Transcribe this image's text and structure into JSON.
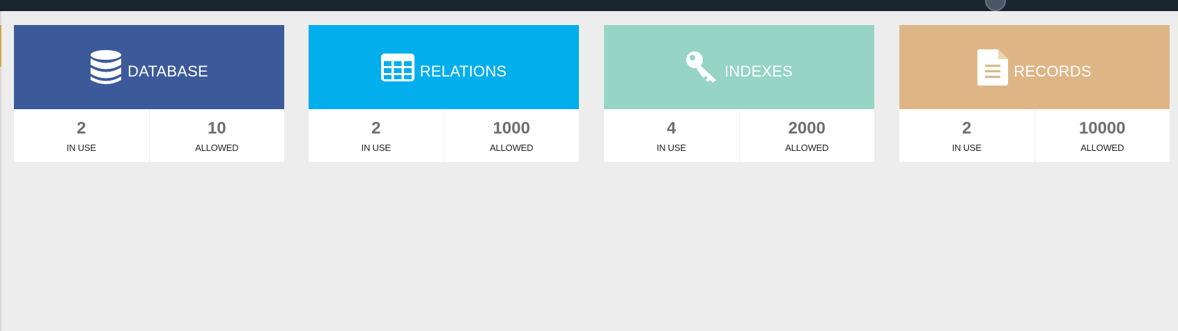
{
  "cards": [
    {
      "title": "DATABASE",
      "icon": "database-icon",
      "color": "#3c5a9a",
      "in_use_value": "2",
      "in_use_label": "IN USE",
      "allowed_value": "10",
      "allowed_label": "ALLOWED"
    },
    {
      "title": "RELATIONS",
      "icon": "table-grid-icon",
      "color": "#03aeed",
      "in_use_value": "2",
      "in_use_label": "IN USE",
      "allowed_value": "1000",
      "allowed_label": "ALLOWED"
    },
    {
      "title": "INDEXES",
      "icon": "key-icon",
      "color": "#96d4c5",
      "in_use_value": "4",
      "in_use_label": "IN USE",
      "allowed_value": "2000",
      "allowed_label": "ALLOWED"
    },
    {
      "title": "RECORDS",
      "icon": "document-icon",
      "color": "#deb686",
      "in_use_value": "2",
      "in_use_label": "IN USE",
      "allowed_value": "10000",
      "allowed_label": "ALLOWED"
    }
  ]
}
